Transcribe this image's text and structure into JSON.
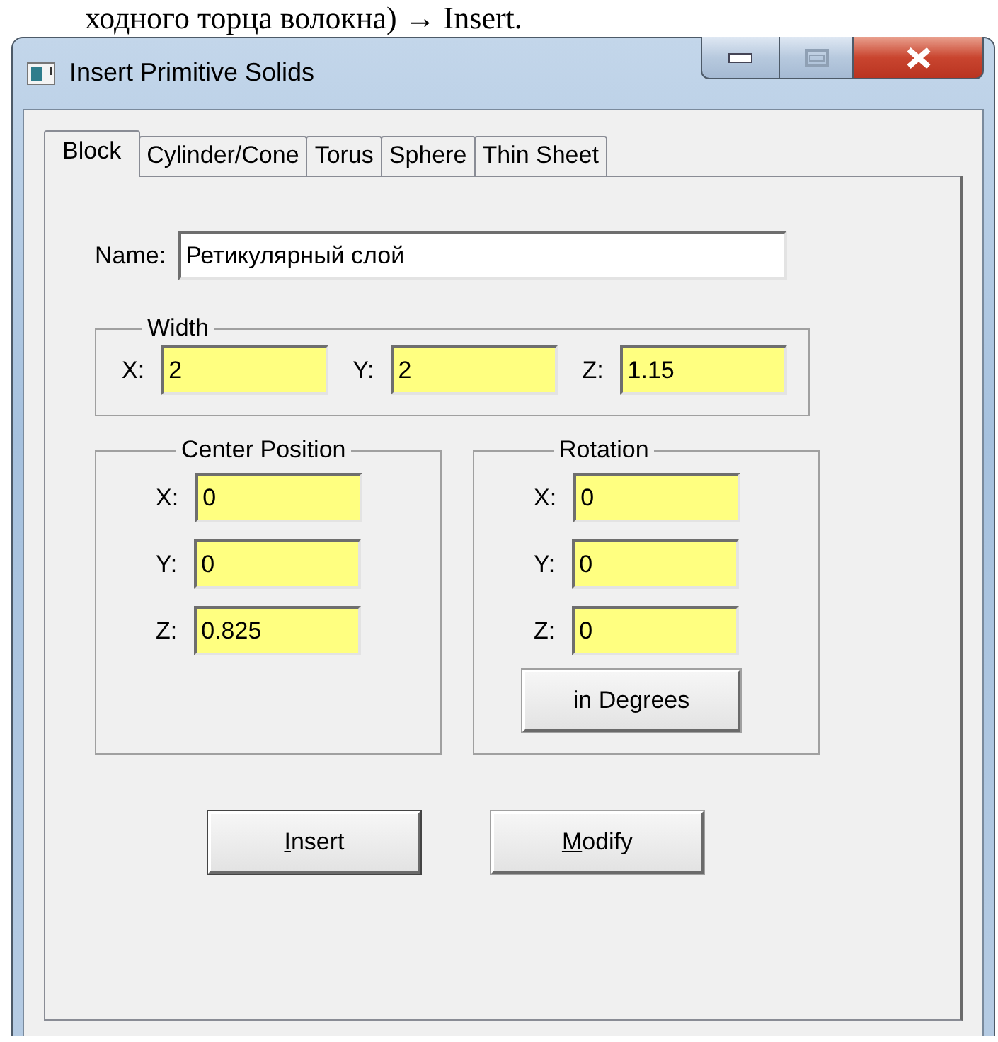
{
  "document_text": "ходного торца волокна) → Insert.",
  "window": {
    "title": "Insert Primitive Solids"
  },
  "tabs": [
    {
      "label": "Block",
      "selected": true
    },
    {
      "label": "Cylinder/Cone",
      "selected": false
    },
    {
      "label": "Torus",
      "selected": false
    },
    {
      "label": "Sphere",
      "selected": false
    },
    {
      "label": "Thin Sheet",
      "selected": false
    }
  ],
  "name": {
    "label": "Name:",
    "value": "Ретикулярный слой"
  },
  "width_group": {
    "title": "Width",
    "fields": [
      {
        "label": "X:",
        "value": "2"
      },
      {
        "label": "Y:",
        "value": "2"
      },
      {
        "label": "Z:",
        "value": "1.15"
      }
    ]
  },
  "center_position": {
    "title": "Center Position",
    "fields": [
      {
        "label": "X:",
        "value": "0"
      },
      {
        "label": "Y:",
        "value": "0"
      },
      {
        "label": "Z:",
        "value": "0.825"
      }
    ]
  },
  "rotation": {
    "title": "Rotation",
    "fields": [
      {
        "label": "X:",
        "value": "0"
      },
      {
        "label": "Y:",
        "value": "0"
      },
      {
        "label": "Z:",
        "value": "0"
      }
    ],
    "units_button": "in Degrees"
  },
  "buttons": [
    {
      "label": "Insert",
      "mnemonic": true,
      "default": true
    },
    {
      "label": "Modify",
      "mnemonic": true,
      "default": false
    }
  ]
}
